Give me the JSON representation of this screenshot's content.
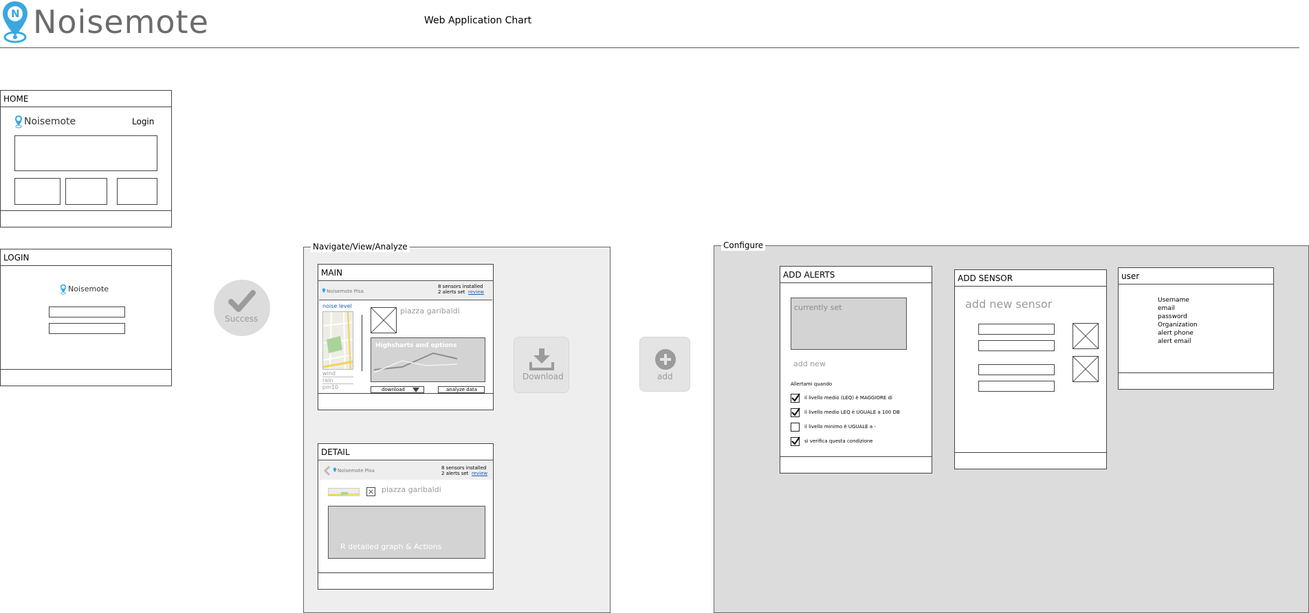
{
  "header": {
    "logo_text": "Noisemote",
    "logo_letter": "N",
    "title": "Web Application Chart"
  },
  "home": {
    "title": "HOME",
    "brand": "Noisemote",
    "login_link": "Login"
  },
  "login": {
    "title": "LOGIN",
    "brand": "Noisemote"
  },
  "success_label": "Success",
  "navigate_group": "Navigate/View/Analyze",
  "main": {
    "title": "MAIN",
    "brand": "Noisemote Pisa",
    "sensors_installed": "8 sensors installed",
    "alerts_set": "2 alerts set",
    "review_link": "review",
    "noise_level": "noise level",
    "place": "piazza garibaldi",
    "chart_label": "Highsharts and options",
    "metric_labels": [
      "wind",
      "rain",
      "pm10"
    ],
    "download_label": "download",
    "analyze_label": "analyze data"
  },
  "detail": {
    "title": "DETAIL",
    "brand": "Noisemote Pisa",
    "sensors_installed": "8 sensors installed",
    "alerts_set": "2 alerts set",
    "review_link": "review",
    "place": "piazza garibaldi",
    "graph_label": "R detailed graph & Actions"
  },
  "download_button": "Download",
  "add_button": "add",
  "configure_group": "Configure",
  "add_alerts": {
    "title": "ADD ALERTS",
    "current_label": "currently set",
    "add_new": "add new",
    "alert_when": "Allertami quando",
    "conditions": [
      {
        "label": "il livello medio (LEQ) è MAGGIORE di",
        "checked": true
      },
      {
        "label": "il livello medio LEQ è UGUALE a 100 DB",
        "checked": true
      },
      {
        "label": "il livello minimo è UGUALE a -",
        "checked": false
      },
      {
        "label": "si verifica questa condizione",
        "checked": true
      }
    ]
  },
  "add_sensor": {
    "title": "ADD SENSOR",
    "heading": "add new sensor"
  },
  "user": {
    "title": "user",
    "fields": [
      "Username",
      "email",
      "password",
      "Organization",
      "alert phone",
      "alert email"
    ]
  },
  "colors": {
    "brand_blue": "#3aa7e0",
    "panel_grey": "#d9d9d9",
    "group_grey": "#eeeeee",
    "button_grey": "#e4e4e4",
    "link_blue": "#1d5fb8"
  }
}
